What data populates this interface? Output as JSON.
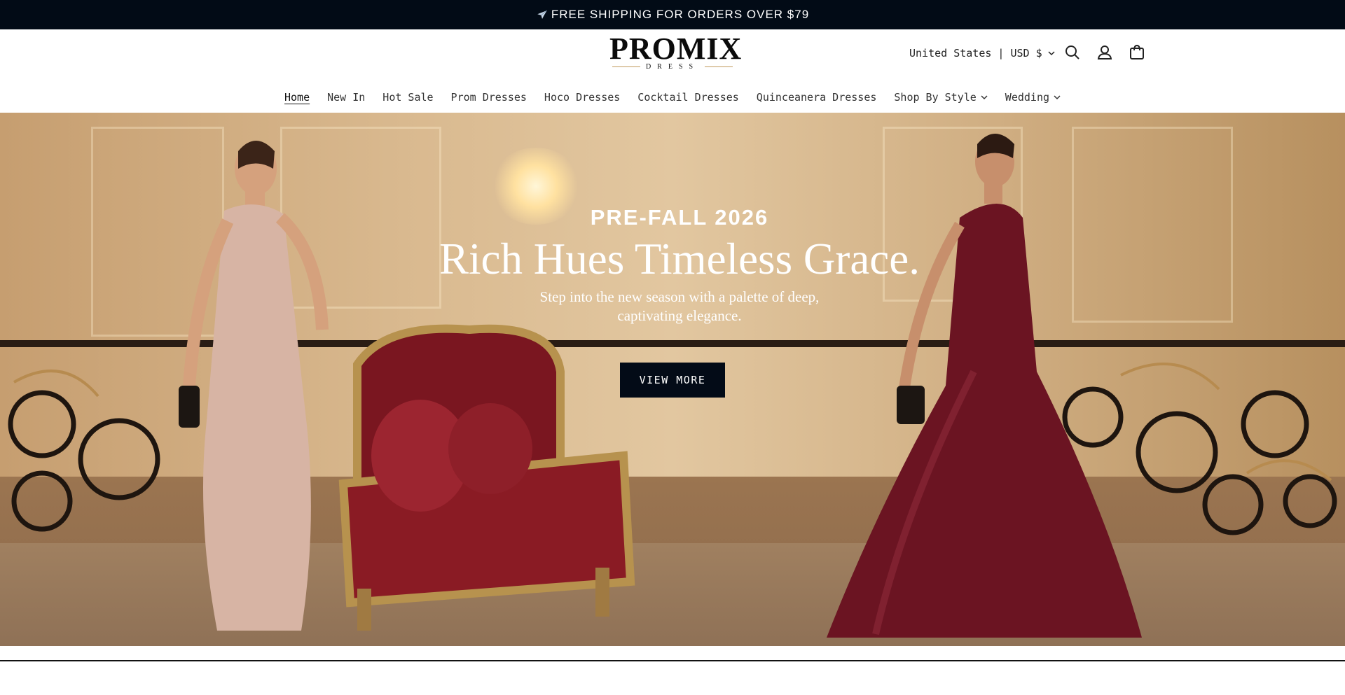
{
  "announcement": {
    "text": "FREE SHIPPING FOR ORDERS OVER $79",
    "icon": "airplane-icon"
  },
  "header": {
    "logo": {
      "brand": "PROMIX",
      "sub": "DRESS"
    },
    "locale": "United States | USD $",
    "icons": [
      "search-icon",
      "account-icon",
      "cart-icon"
    ]
  },
  "nav": {
    "items": [
      {
        "label": "Home",
        "active": true
      },
      {
        "label": "New In"
      },
      {
        "label": "Hot Sale"
      },
      {
        "label": "Prom Dresses"
      },
      {
        "label": "Hoco Dresses"
      },
      {
        "label": "Cocktail Dresses"
      },
      {
        "label": "Quinceanera Dresses"
      },
      {
        "label": "Shop By Style",
        "dropdown": true
      },
      {
        "label": "Wedding",
        "dropdown": true
      }
    ]
  },
  "hero": {
    "kicker": "PRE-FALL 2026",
    "title": "Rich Hues Timeless Grace.",
    "subtitle_line1": "Step into the new season with a palette of deep,",
    "subtitle_line2": "captivating elegance.",
    "button": "VIEW MORE"
  },
  "colors": {
    "topbar": "#020b16",
    "button": "#030b17",
    "burgundy": "#6b1422",
    "gold": "#c19a5b"
  }
}
